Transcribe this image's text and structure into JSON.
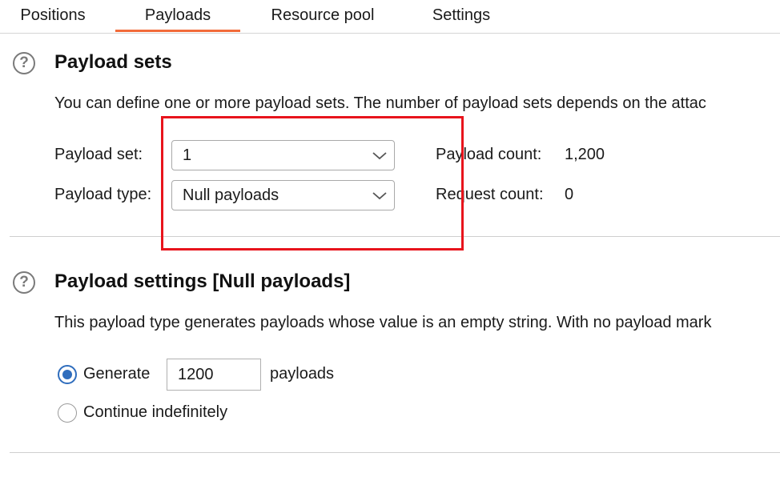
{
  "tabs": [
    {
      "label": "Positions",
      "active": false
    },
    {
      "label": "Payloads",
      "active": true
    },
    {
      "label": "Resource pool",
      "active": false
    },
    {
      "label": "Settings",
      "active": false
    }
  ],
  "colors": {
    "accent_tab": "#f26b3a",
    "highlight_box": "#e8141c",
    "radio_selected": "#2f6dbd"
  },
  "payload_sets": {
    "title": "Payload sets",
    "description": "You can define one or more payload sets. The number of payload sets depends on the attac",
    "set_label": "Payload set:",
    "set_value": "1",
    "type_label": "Payload type:",
    "type_value": "Null payloads",
    "payload_count_label": "Payload count:",
    "payload_count_value": "1,200",
    "request_count_label": "Request count:",
    "request_count_value": "0"
  },
  "payload_settings": {
    "title": "Payload settings [Null payloads]",
    "description": "This payload type generates payloads whose value is an empty string. With no payload mark",
    "generate_label": "Generate",
    "generate_value": "1200",
    "payloads_suffix": "payloads",
    "continue_label": "Continue indefinitely",
    "selected_option": "Generate"
  },
  "icons": {
    "help": "help-circle-icon",
    "dropdown": "chevron-down-icon"
  }
}
